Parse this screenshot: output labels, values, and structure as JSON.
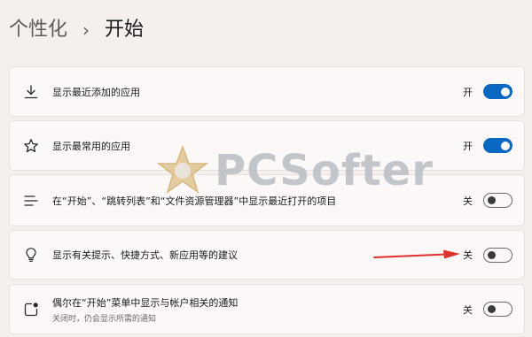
{
  "breadcrumb": {
    "parent": "个性化",
    "separator": "›",
    "current": "开始"
  },
  "settings": [
    {
      "icon": "download-arrow-icon",
      "title": "显示最近添加的应用",
      "state_label": "开",
      "on": true
    },
    {
      "icon": "star-icon",
      "title": "显示最常用的应用",
      "state_label": "开",
      "on": true
    },
    {
      "icon": "list-lines-icon",
      "title": "在“开始”、“跳转列表”和“文件资源管理器”中显示最近打开的项目",
      "state_label": "关",
      "on": false
    },
    {
      "icon": "lightbulb-icon",
      "title": "显示有关提示、快捷方式、新应用等的建议",
      "state_label": "关",
      "on": false
    },
    {
      "icon": "notification-dot-icon",
      "title": "偶尔在“开始”菜单中显示与帐户相关的通知",
      "subtitle": "关闭时，仍会显示所需的通知",
      "state_label": "关",
      "on": false
    }
  ],
  "watermark": {
    "text": "PCSofter"
  },
  "colors": {
    "accent": "#0a67c2",
    "annotation_arrow": "#e0302b"
  }
}
